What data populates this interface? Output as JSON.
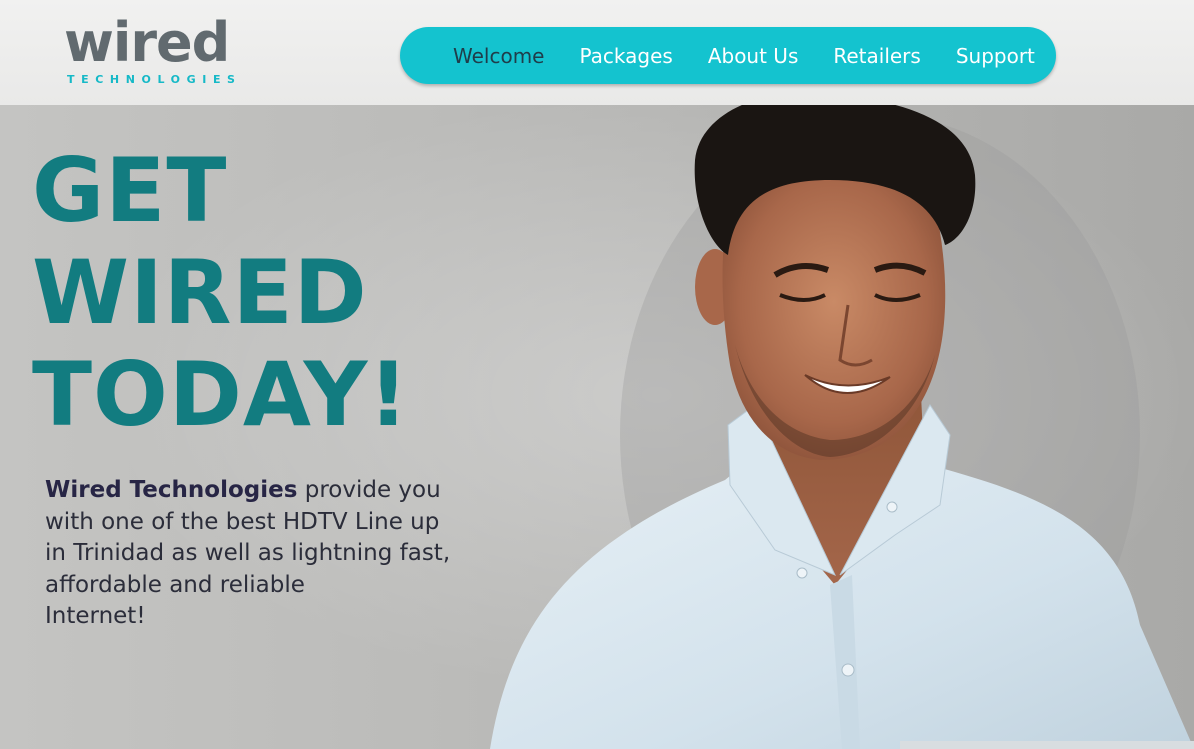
{
  "header": {
    "logo": {
      "word": "wired",
      "sub": "TECHNOLOGIES"
    },
    "nav": {
      "items": [
        {
          "label": "Welcome",
          "active": true
        },
        {
          "label": "Packages",
          "active": false
        },
        {
          "label": "About Us",
          "active": false
        },
        {
          "label": "Retailers",
          "active": false
        },
        {
          "label": "Support",
          "active": false
        }
      ]
    }
  },
  "hero": {
    "headline": [
      "GET",
      "WIRED",
      "TODAY!"
    ],
    "intro_brand": "Wired Technologies",
    "intro_lines": [
      "provide you",
      "with one of the best HDTV Line up",
      "in Trinidad as well as lightning fast,",
      "affordable and reliable",
      "Internet!"
    ]
  },
  "colors": {
    "accent": "#14c3cf",
    "headline": "#127c80",
    "nav_active": "#1f3d4a",
    "logo_gray": "#616a6f",
    "logo_teal": "#16b9c7"
  },
  "icons": {
    "hero_image": "smiling-man-with-laptop-photo"
  }
}
